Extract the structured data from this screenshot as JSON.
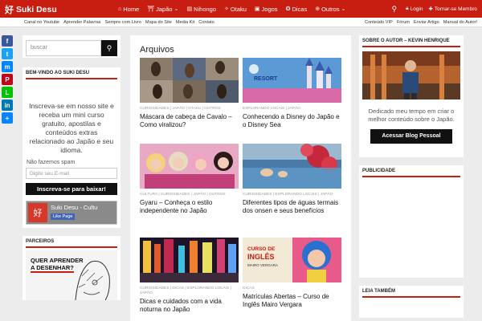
{
  "brand": {
    "name": "Suki Desu",
    "accent": "#c81d11"
  },
  "nav": {
    "items": [
      {
        "label": "Home",
        "icon": "home-icon"
      },
      {
        "label": "Japão",
        "icon": "japan-icon"
      },
      {
        "label": "Nihongo",
        "icon": "language-icon"
      },
      {
        "label": "Otaku",
        "icon": "otaku-icon"
      },
      {
        "label": "Jogos",
        "icon": "game-icon"
      },
      {
        "label": "Dicas",
        "icon": "lightbulb-icon"
      },
      {
        "label": "Outros",
        "icon": "plus-icon"
      }
    ],
    "login": "Login",
    "member": "Tornar-se Membro"
  },
  "subnav": {
    "left": [
      "Canal no Youtube",
      "Aprender Palavras",
      "Sempre com Livro",
      "Mapa do Site",
      "Media Kit",
      "Contato"
    ],
    "right": [
      "Conteúdo VIP",
      "Fórum",
      "Enviar Artigo",
      "Manual do Autor!"
    ]
  },
  "share": [
    {
      "label": "f",
      "color": "#3b5998"
    },
    {
      "label": "t",
      "color": "#1da1f2"
    },
    {
      "label": "m",
      "color": "#0084ff"
    },
    {
      "label": "P",
      "color": "#bd081c"
    },
    {
      "label": "L",
      "color": "#00c300"
    },
    {
      "label": "in",
      "color": "#0077b5"
    },
    {
      "label": "+",
      "color": "#0a84ff"
    }
  ],
  "left_sidebar": {
    "search_placeholder": "buscar",
    "welcome_title": "Bem-vindo ao Suki Desu",
    "welcome_text": "Inscreva-se em nosso site e receba um mini curso gratuito, apostilas e conteúdos extras relacionado ao Japão e seu idioma.",
    "spam": "Não fazemos spam",
    "email_placeholder": "Digite seu E-mail",
    "subscribe": "Inscreva-se para baixar!",
    "fb_name": "Suki Desu - Cultu",
    "fb_like": "Like Page",
    "partners_title": "Parceiros",
    "partner_ad_line1": "Quer aprender",
    "partner_ad_line2": "a desenhar?"
  },
  "main": {
    "title": "Arquivos",
    "posts": [
      {
        "cats": "Curiosidades | Japão | Otaku | Outros",
        "title": "Máscara de cabeça de Cavalo – Como viralizou?"
      },
      {
        "cats": "Explorando Locais | Japão",
        "title": "Conhecendo a Disney do Japão e o Disney Sea",
        "badge": "RESORT"
      },
      {
        "cats": "Cultura | Curiosidades | Japão | Outros",
        "title": "Gyaru – Conheça o estilo independente no Japão"
      },
      {
        "cats": "Curiosidades | Explorando Locais | Japão",
        "title": "Diferentes tipos de águas termais dos onsen e seus benefícios"
      },
      {
        "cats": "Curiosidades | Dicas | Explorando Locais | Japão",
        "title": "Dicas e cuidados com a vida noturna no Japão"
      },
      {
        "cats": "Dicas",
        "title": "Matrículas Abertas – Curso de Inglês Mairo Vergara",
        "badge_line1": "CURSO DE",
        "badge_line2": "INGLÊS",
        "badge_line3": "MAIRO VERGARA"
      }
    ]
  },
  "right_sidebar": {
    "author_title": "Sobre o autor – Kevin Henrique",
    "author_text": "Dedicado meu tempo em criar o melhor conteúdo sobre o Japão.",
    "blog_button": "Acessar Blog Pessoal",
    "ads_title": "Publicidade",
    "read_also_title": "Leia também"
  }
}
